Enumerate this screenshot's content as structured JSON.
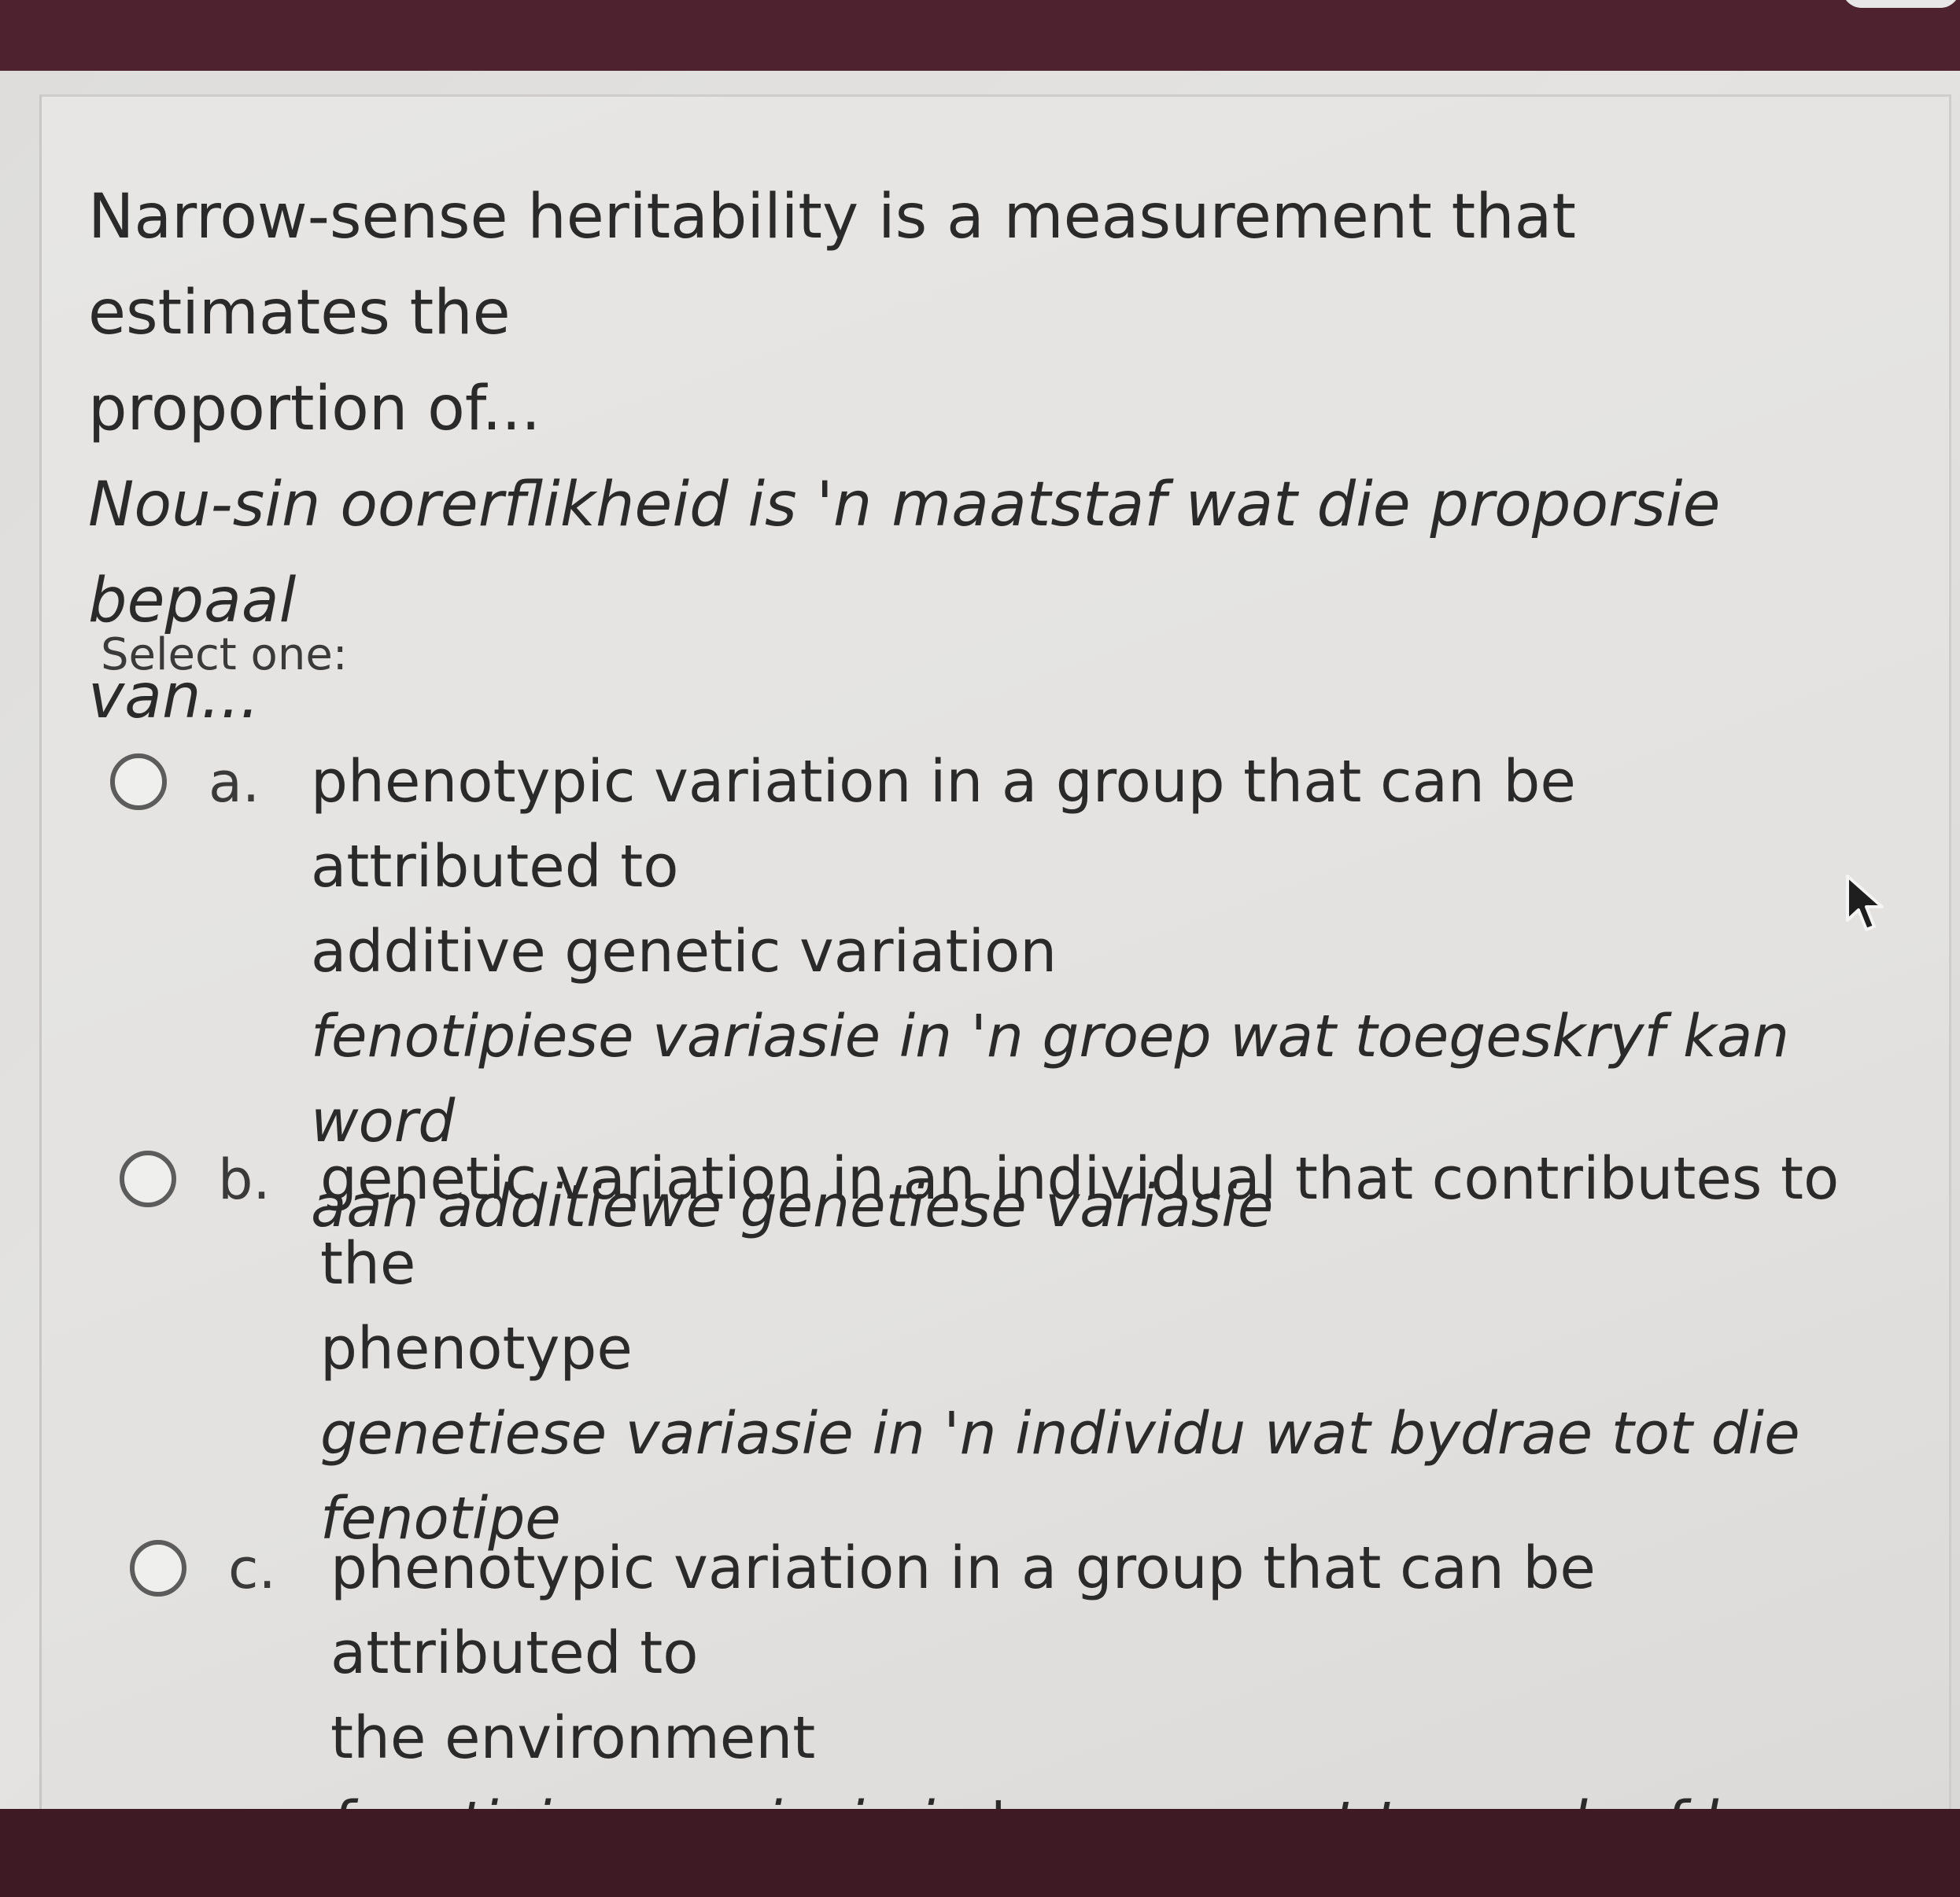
{
  "question": {
    "english_line1": "Narrow-sense heritability is a measurement that estimates the",
    "english_line2": "proportion of...",
    "afrikaans_line1": "Nou-sin oorerflikheid is 'n maatstaf wat die proporsie bepaal",
    "afrikaans_line2": "van..."
  },
  "prompt_label": "Select one:",
  "options": [
    {
      "letter": "a.",
      "en_line1": "phenotypic variation in a group that can be attributed to",
      "en_line2": "additive genetic variation",
      "af_line1": "fenotipiese variasie in 'n groep wat toegeskryf kan word",
      "af_line2": "aan additiewe genetiese variasie"
    },
    {
      "letter": "b.",
      "en_line1": "genetic variation in an individual that contributes to the",
      "en_line2": "phenotype",
      "af_line1": "genetiese variasie in 'n individu wat bydrae tot die",
      "af_line2": "fenotipe"
    },
    {
      "letter": "c.",
      "en_line1": "phenotypic variation in a group that can be attributed to",
      "en_line2": "the environment",
      "af_line1": "fenotipiese variasie in 'n groep wat toegeskryf kan word",
      "af_line2": ""
    }
  ],
  "colors": {
    "frame": "#4f2230",
    "page": "#e3e2e0",
    "text": "#2a2a2a"
  }
}
